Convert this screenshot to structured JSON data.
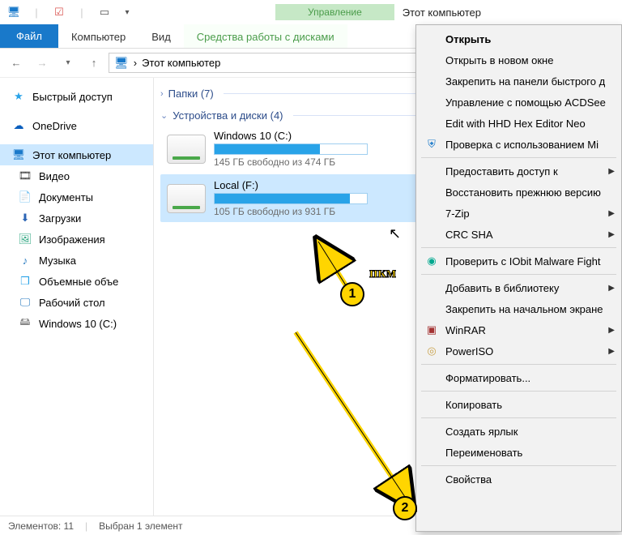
{
  "titlebar": {
    "management_label": "Управление",
    "location": "Этот компьютер"
  },
  "ribbon": {
    "file": "Файл",
    "computer": "Компьютер",
    "view": "Вид",
    "disk_tools": "Средства работы с дисками"
  },
  "address": {
    "location": "Этот компьютер",
    "chevron": "›"
  },
  "sidebar": {
    "quick_access": "Быстрый доступ",
    "onedrive": "OneDrive",
    "this_pc": "Этот компьютер",
    "video": "Видео",
    "documents": "Документы",
    "downloads": "Загрузки",
    "pictures": "Изображения",
    "music": "Музыка",
    "objects3d": "Объемные объе",
    "desktop": "Рабочий стол",
    "win10": "Windows 10 (C:)"
  },
  "groups": {
    "folders": "Папки (7)",
    "devices": "Устройства и диски (4)"
  },
  "drives": [
    {
      "name": "Windows 10 (C:)",
      "free_text": "145 ГБ свободно из 474 ГБ",
      "fill_pct": 69
    },
    {
      "name": "Local (F:)",
      "free_text": "105 ГБ свободно из 931 ГБ",
      "fill_pct": 89
    }
  ],
  "status": {
    "items": "Элементов: 11",
    "selected": "Выбран 1 элемент"
  },
  "context_menu": {
    "open": "Открыть",
    "open_new": "Открыть в новом окне",
    "pin_quick": "Закрепить на панели быстрого д",
    "acdsee": "Управление с помощью ACDSee",
    "hexedit": "Edit with HHD Hex Editor Neo",
    "defender": "Проверка с использованием Mi",
    "grant_access": "Предоставить доступ к",
    "restore": "Восстановить прежнюю версию",
    "sevenzip": "7-Zip",
    "crcsha": "CRC SHA",
    "iobit": "Проверить с IObit Malware Fight",
    "add_lib": "Добавить в библиотеку",
    "pin_start": "Закрепить на начальном экране",
    "winrar": "WinRAR",
    "poweriso": "PowerISO",
    "format": "Форматировать...",
    "copy": "Копировать",
    "shortcut": "Создать ярлык",
    "rename": "Переименовать",
    "properties": "Свойства"
  },
  "annotations": {
    "marker1": "1",
    "marker2": "2",
    "rmb": "пкм"
  }
}
